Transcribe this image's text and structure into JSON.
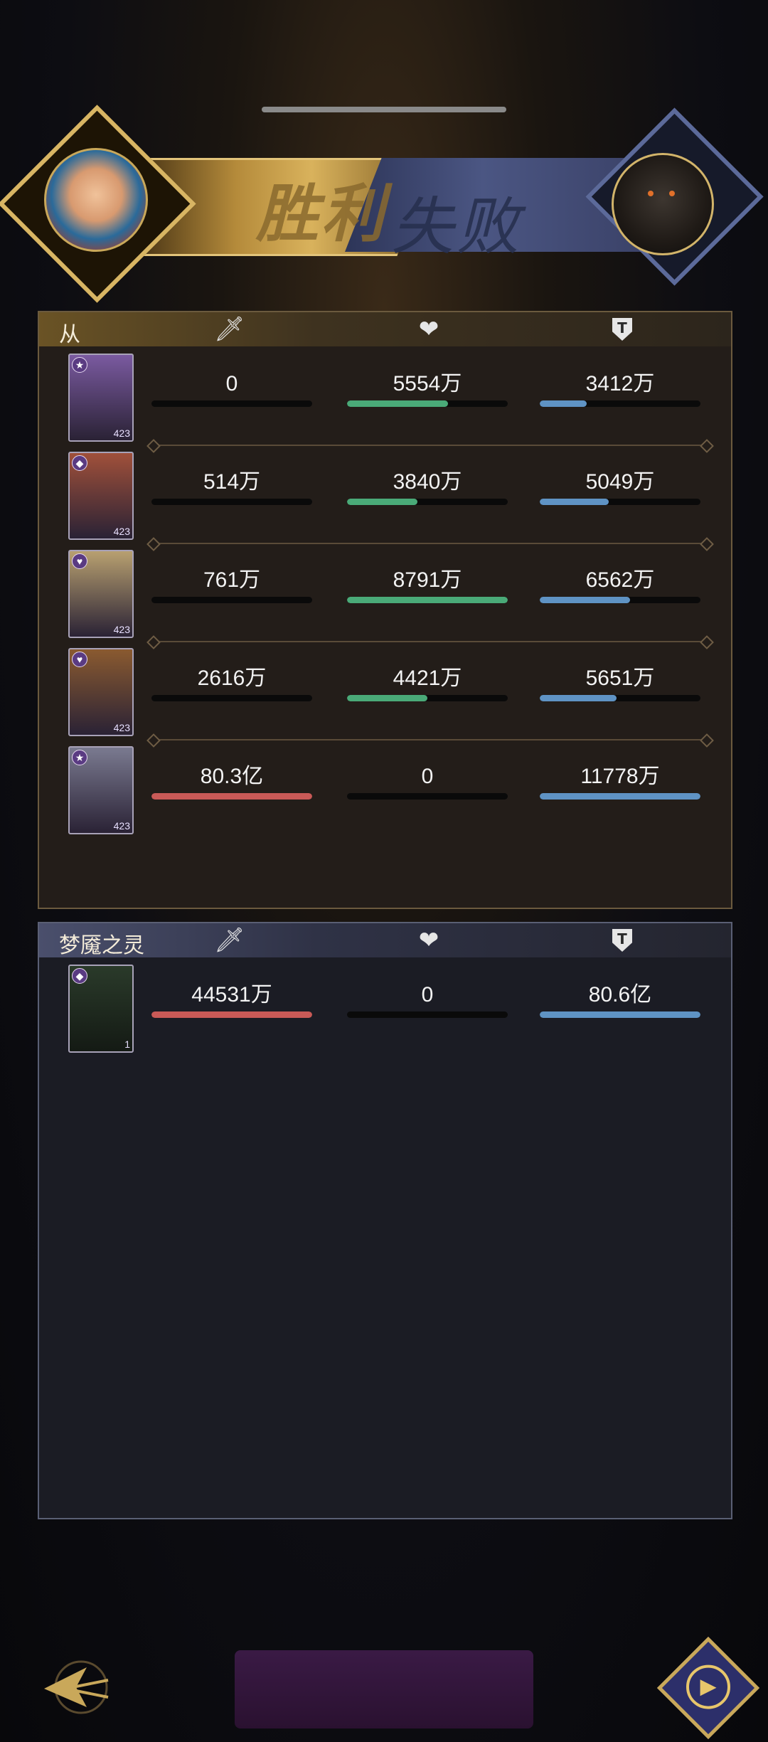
{
  "banner": {
    "win_label": "胜利",
    "lose_label": "失败"
  },
  "ally": {
    "title": "从",
    "rows": [
      {
        "damage": "0",
        "heal": "5554万",
        "defense": "3412万",
        "damage_fill": 0.0,
        "heal_fill": 0.63,
        "defense_fill": 0.29,
        "level": "423",
        "badge": "★"
      },
      {
        "damage": "514万",
        "heal": "3840万",
        "defense": "5049万",
        "damage_fill": 0.0,
        "heal_fill": 0.44,
        "defense_fill": 0.43,
        "level": "423",
        "badge": "◆"
      },
      {
        "damage": "761万",
        "heal": "8791万",
        "defense": "6562万",
        "damage_fill": 0.0,
        "heal_fill": 1.0,
        "defense_fill": 0.56,
        "level": "423",
        "badge": "♥"
      },
      {
        "damage": "2616万",
        "heal": "4421万",
        "defense": "5651万",
        "damage_fill": 0.0,
        "heal_fill": 0.5,
        "defense_fill": 0.48,
        "level": "423",
        "badge": "♥"
      },
      {
        "damage": "80.3亿",
        "heal": "0",
        "defense": "11778万",
        "damage_fill": 1.0,
        "heal_fill": 0.0,
        "defense_fill": 1.0,
        "level": "423",
        "badge": "★"
      }
    ]
  },
  "enemy": {
    "title": "梦魇之灵",
    "rows": [
      {
        "damage": "44531万",
        "heal": "0",
        "defense": "80.6亿",
        "damage_fill": 1.0,
        "heal_fill": 0.0,
        "defense_fill": 1.0,
        "level": "1",
        "badge": "◆"
      }
    ]
  },
  "icons": {
    "attack": "sword-icon",
    "heal": "heart-icon",
    "defense": "shield-icon",
    "back": "back-arrow-icon",
    "replay": "replay-icon"
  },
  "colors": {
    "damage": "#c95a57",
    "heal": "#4aaa78",
    "defense": "#5f93c4"
  }
}
